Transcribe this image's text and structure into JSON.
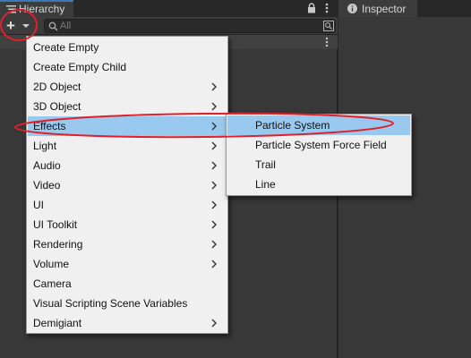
{
  "hierarchy": {
    "tab_label": "Hierarchy",
    "search_placeholder": "All"
  },
  "inspector": {
    "tab_label": "Inspector"
  },
  "main_menu": {
    "items": [
      {
        "label": "Create Empty",
        "submenu": false
      },
      {
        "label": "Create Empty Child",
        "submenu": false
      },
      {
        "label": "2D Object",
        "submenu": true
      },
      {
        "label": "3D Object",
        "submenu": true
      },
      {
        "label": "Effects",
        "submenu": true,
        "highlighted": true
      },
      {
        "label": "Light",
        "submenu": true
      },
      {
        "label": "Audio",
        "submenu": true
      },
      {
        "label": "Video",
        "submenu": true
      },
      {
        "label": "UI",
        "submenu": true
      },
      {
        "label": "UI Toolkit",
        "submenu": true
      },
      {
        "label": "Rendering",
        "submenu": true
      },
      {
        "label": "Volume",
        "submenu": true
      },
      {
        "label": "Camera",
        "submenu": false
      },
      {
        "label": "Visual Scripting Scene Variables",
        "submenu": false
      },
      {
        "label": "Demigiant",
        "submenu": true
      }
    ]
  },
  "effects_submenu": {
    "items": [
      {
        "label": "Particle System",
        "highlighted": true
      },
      {
        "label": "Particle System Force Field"
      },
      {
        "label": "Trail"
      },
      {
        "label": "Line"
      }
    ]
  },
  "icons": {
    "tab": "hierarchy-list-icon",
    "lock": "lock-icon",
    "more": "kebab-menu-icon",
    "add": "plus-icon",
    "search": "search-icon",
    "scene_search": "scene-search-icon",
    "info": "info-icon",
    "submenu": "chevron-right-icon"
  },
  "colors": {
    "panel_bg": "#383838",
    "tab_accent": "#3a79bb",
    "menu_bg": "#f0f0f0",
    "menu_highlight": "#99c9ef",
    "annotation": "#e0202a"
  }
}
